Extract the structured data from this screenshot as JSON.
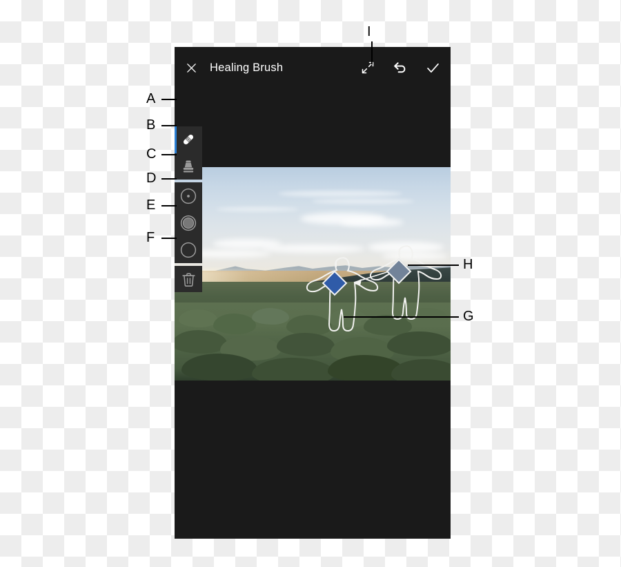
{
  "app": {
    "title": "Healing Brush",
    "header_icons": [
      {
        "name": "close-icon",
        "glyph": "✕"
      },
      {
        "name": "expand-icon",
        "glyph": "⤢"
      },
      {
        "name": "undo-icon",
        "glyph": "↺"
      },
      {
        "name": "confirm-check-icon",
        "glyph": "✓"
      }
    ],
    "accent_color": "#2a7fd4",
    "panel_color": "#2b2b2b",
    "background_color": "#1a1a1a"
  },
  "toolbar": {
    "tool_group": [
      {
        "name": "healing-brush-tool",
        "label": "Healing Brush",
        "active": true
      },
      {
        "name": "clone-stamp-tool",
        "label": "Clone Stamp",
        "active": false
      }
    ],
    "brush_group": [
      {
        "name": "brush-size-tool",
        "label": "Brush Size",
        "active": false
      },
      {
        "name": "brush-opacity-tool",
        "label": "Opacity",
        "active": false
      },
      {
        "name": "brush-feather-tool",
        "label": "Feather",
        "active": false
      }
    ],
    "delete_group": [
      {
        "name": "delete-tool",
        "label": "Delete",
        "active": false
      }
    ]
  },
  "canvas": {
    "selections": [
      {
        "name": "target-selection",
        "label": "Target",
        "handle_color": "#2f5ba8"
      },
      {
        "name": "source-selection",
        "label": "Source",
        "handle_color": "#728399"
      }
    ],
    "connector": {
      "name": "source-to-target-arrow",
      "direction": "right-to-left"
    }
  },
  "callouts": [
    {
      "id": "A",
      "target": "healing-brush-tool"
    },
    {
      "id": "B",
      "target": "clone-stamp-tool"
    },
    {
      "id": "C",
      "target": "brush-size-tool"
    },
    {
      "id": "D",
      "target": "brush-opacity-tool"
    },
    {
      "id": "E",
      "target": "brush-feather-tool"
    },
    {
      "id": "F",
      "target": "delete-tool"
    },
    {
      "id": "G",
      "target": "target-selection"
    },
    {
      "id": "H",
      "target": "source-selection"
    },
    {
      "id": "I",
      "target": "expand-icon"
    }
  ]
}
